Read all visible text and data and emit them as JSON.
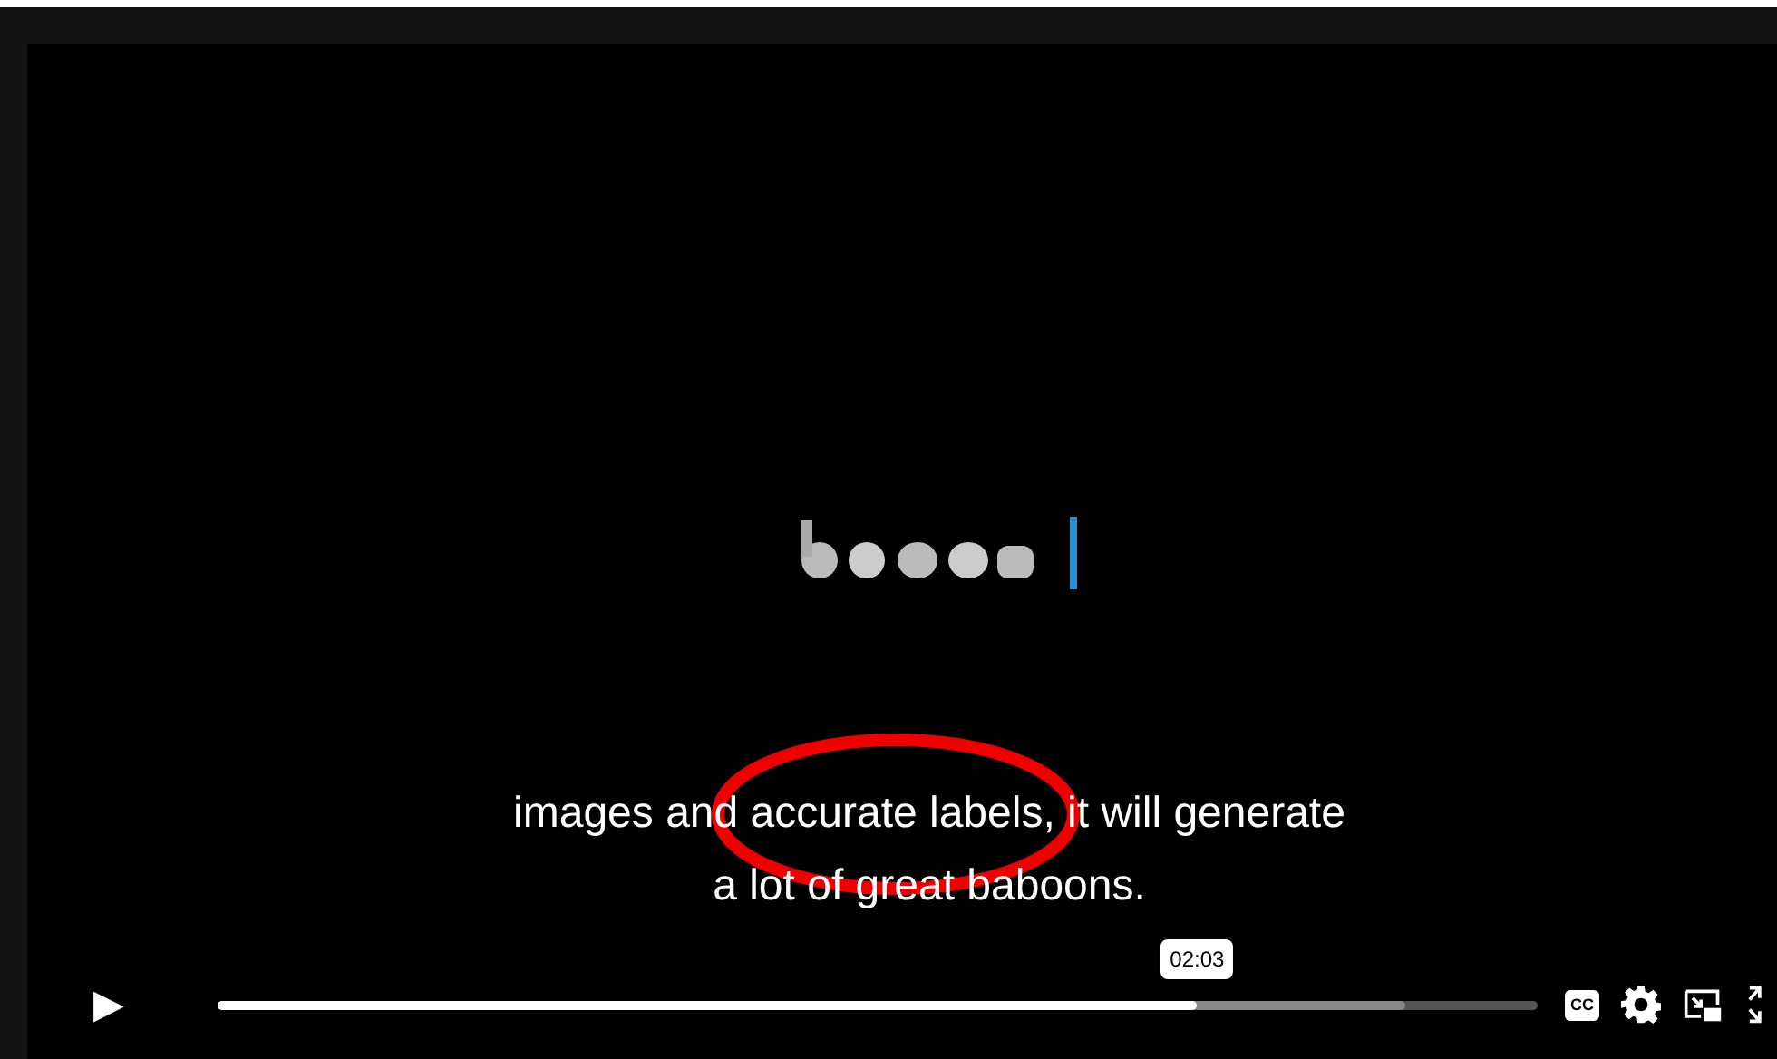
{
  "captions": [
    "images and accurate labels, it will generate",
    "a lot of great baboons."
  ],
  "annotation": {
    "color": "#ee0000"
  },
  "controls": {
    "play": "▶",
    "time_tooltip": "02:03",
    "progress": {
      "level": 0.742
    },
    "buffer": {
      "level": 0.9
    },
    "captions_button": "CC"
  }
}
